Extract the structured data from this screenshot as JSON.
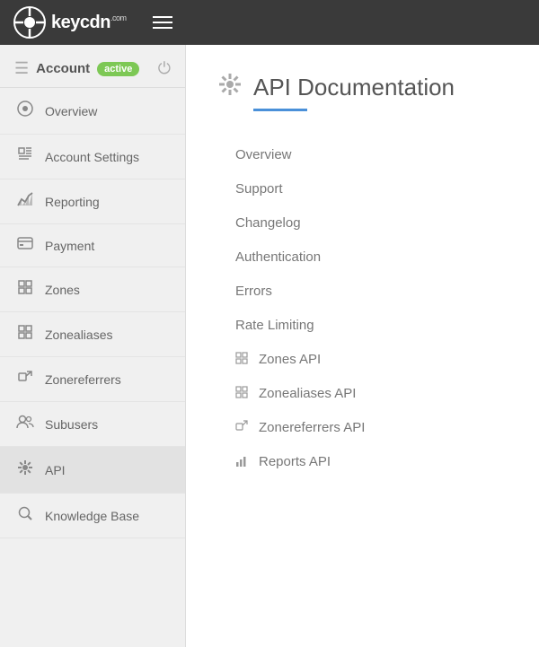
{
  "topbar": {
    "logo_text": "keycdn",
    "logo_suffix": ".com",
    "hamburger_label": "Menu"
  },
  "sidebar": {
    "account_label": "Account",
    "active_badge": "active",
    "nav_items": [
      {
        "id": "overview",
        "label": "Overview",
        "icon": "🎨"
      },
      {
        "id": "account-settings",
        "label": "Account Settings",
        "icon": "✏️"
      },
      {
        "id": "reporting",
        "label": "Reporting",
        "icon": "📊"
      },
      {
        "id": "payment",
        "label": "Payment",
        "icon": "💳"
      },
      {
        "id": "zones",
        "label": "Zones",
        "icon": "⊞"
      },
      {
        "id": "zonealiases",
        "label": "Zonealiases",
        "icon": "⊞"
      },
      {
        "id": "zonereferrers",
        "label": "Zonereferrers",
        "icon": "↗"
      },
      {
        "id": "subusers",
        "label": "Subusers",
        "icon": "👥"
      },
      {
        "id": "api",
        "label": "API",
        "icon": "✳"
      },
      {
        "id": "knowledge-base",
        "label": "Knowledge Base",
        "icon": "🔍"
      }
    ]
  },
  "main": {
    "page_title": "API Documentation",
    "page_title_icon": "✳",
    "api_links": [
      {
        "id": "overview",
        "label": "Overview",
        "icon": ""
      },
      {
        "id": "support",
        "label": "Support",
        "icon": ""
      },
      {
        "id": "changelog",
        "label": "Changelog",
        "icon": ""
      },
      {
        "id": "authentication",
        "label": "Authentication",
        "icon": ""
      },
      {
        "id": "errors",
        "label": "Errors",
        "icon": ""
      },
      {
        "id": "rate-limiting",
        "label": "Rate Limiting",
        "icon": ""
      },
      {
        "id": "zones-api",
        "label": "Zones API",
        "icon": "⊞"
      },
      {
        "id": "zonealiases-api",
        "label": "Zonealiases API",
        "icon": "⊞"
      },
      {
        "id": "zonereferrers-api",
        "label": "Zonereferrers API",
        "icon": "↗"
      },
      {
        "id": "reports-api",
        "label": "Reports API",
        "icon": "📊"
      }
    ]
  }
}
